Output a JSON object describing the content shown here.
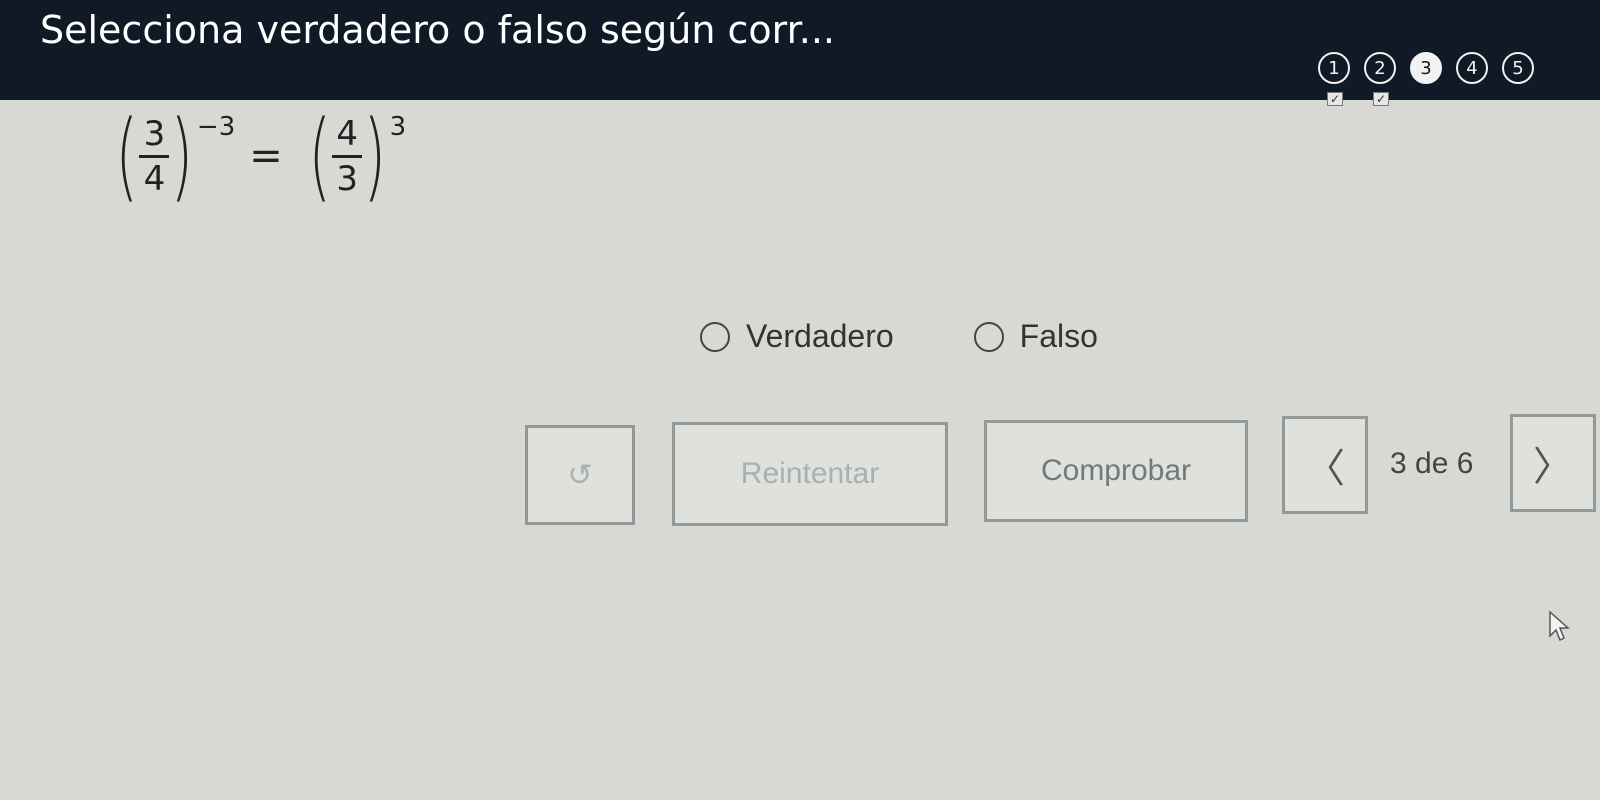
{
  "header": {
    "title": "Selecciona verdadero o falso según corr...",
    "steps": [
      {
        "label": "1",
        "checked": true,
        "current": false
      },
      {
        "label": "2",
        "checked": true,
        "current": false
      },
      {
        "label": "3",
        "checked": false,
        "current": true
      },
      {
        "label": "4",
        "checked": false,
        "current": false
      },
      {
        "label": "5",
        "checked": false,
        "current": false
      }
    ],
    "check_mark": "✓"
  },
  "question": {
    "left": {
      "numerator": "3",
      "denominator": "4",
      "exponent": "−3"
    },
    "equals": "=",
    "right": {
      "numerator": "4",
      "denominator": "3",
      "exponent": "3"
    }
  },
  "options": [
    {
      "label": "Verdadero",
      "selected": false
    },
    {
      "label": "Falso",
      "selected": false
    }
  ],
  "actions": {
    "undo_icon": "↺",
    "retry_label": "Reintentar",
    "check_label": "Comprobar",
    "prev_icon": "〈",
    "next_icon": "〉",
    "page_indicator": "3 de 6"
  },
  "colors": {
    "header_bg": "#0f1a26",
    "page_bg": "#d8d8d4",
    "button_border": "#8f9a99"
  }
}
